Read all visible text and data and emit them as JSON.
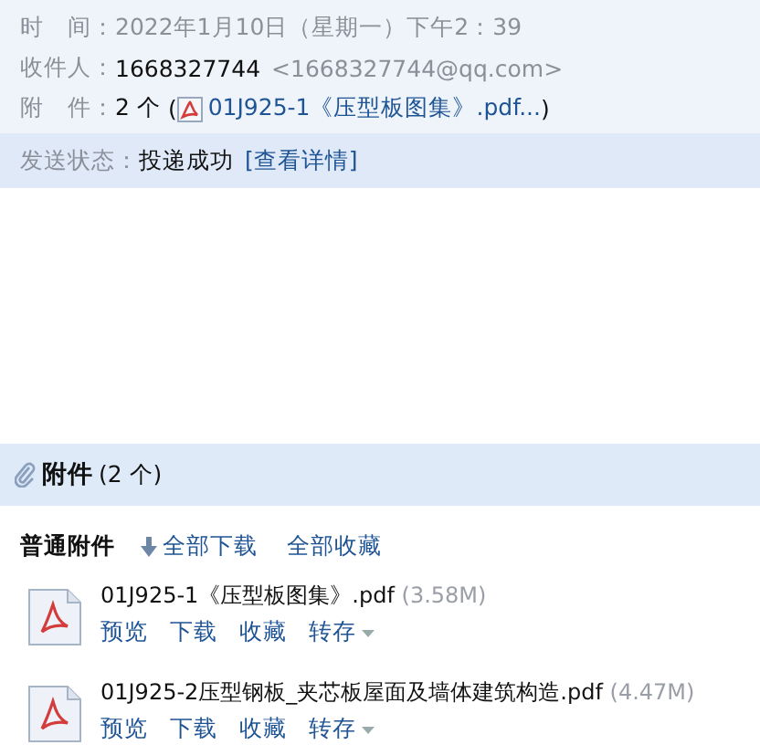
{
  "header": {
    "fields": [
      {
        "label": "时　间：",
        "value": "2022年1月10日（星期一）下午2：39",
        "kind": "time"
      },
      {
        "label": "收件人：",
        "value": "1668327744",
        "extra": "<1668327744@qq.com>",
        "kind": "recipient"
      },
      {
        "label": "附　件：",
        "value": "2 个",
        "open": "(",
        "extra": "01J925-1《压型板图集》.pdf...",
        "close": ")",
        "kind": "attachment"
      }
    ]
  },
  "status": {
    "label": "发送状态：",
    "value": "投递成功",
    "link": "[查看详情]"
  },
  "attachments": {
    "title": "附件",
    "count": "(2 个)",
    "group": "普通附件",
    "download_all": "全部下载",
    "save_all": "全部收藏",
    "files": [
      {
        "name": "01J925-1《压型板图集》.pdf",
        "size": "(3.58M)",
        "actions": [
          "预览",
          "下载",
          "收藏",
          "转存"
        ]
      },
      {
        "name": "01J925-2压型钢板_夹芯板屋面及墙体建筑构造.pdf",
        "size": "(4.47M)",
        "actions": [
          "预览",
          "下载",
          "收藏",
          "转存"
        ]
      }
    ]
  }
}
